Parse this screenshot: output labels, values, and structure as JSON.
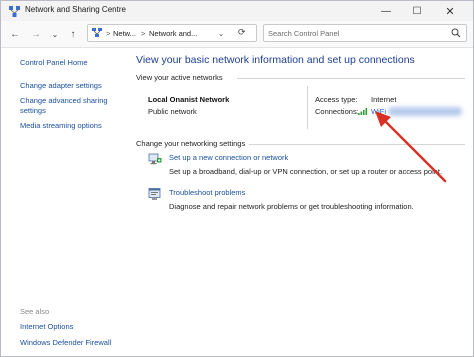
{
  "window": {
    "title": "Network and Sharing Centre",
    "controls": {
      "minimize": "—",
      "maximize": "☐",
      "close": "✕"
    }
  },
  "nav": {
    "back": "←",
    "forward": "→",
    "recent": "⌄",
    "up": "↑",
    "breadcrumb": [
      "Netw...",
      "Network and..."
    ],
    "breadcrumb_sep": ">",
    "dropdown": "⌄",
    "refresh": "⟳",
    "search_placeholder": "Search Control Panel"
  },
  "sidebar": {
    "items": [
      {
        "label": "Control Panel Home"
      },
      {
        "label": "Change adapter settings"
      },
      {
        "label": "Change advanced sharing settings"
      },
      {
        "label": "Media streaming options"
      }
    ],
    "see_also_title": "See also",
    "see_also": [
      {
        "label": "Internet Options"
      },
      {
        "label": "Windows Defender Firewall"
      }
    ]
  },
  "main": {
    "title": "View your basic network information and set up connections",
    "active_header": "View your active networks",
    "network": {
      "name": "Local Onanist Network",
      "type": "Public network",
      "access_type_label": "Access type:",
      "access_type_value": "Internet",
      "connections_label": "Connections:",
      "connection_name": "WiFi"
    },
    "settings_header": "Change your networking settings",
    "tasks": [
      {
        "link": "Set up a new connection or network",
        "desc": "Set up a broadband, dial-up or VPN connection, or set up a router or access point.",
        "icon": "network-setup-icon"
      },
      {
        "link": "Troubleshoot problems",
        "desc": "Diagnose and repair network problems or get troubleshooting information.",
        "icon": "troubleshoot-icon"
      }
    ]
  },
  "colors": {
    "link": "#1a4f9c",
    "title": "#1c3f8f",
    "annotation_arrow": "#d93025"
  }
}
